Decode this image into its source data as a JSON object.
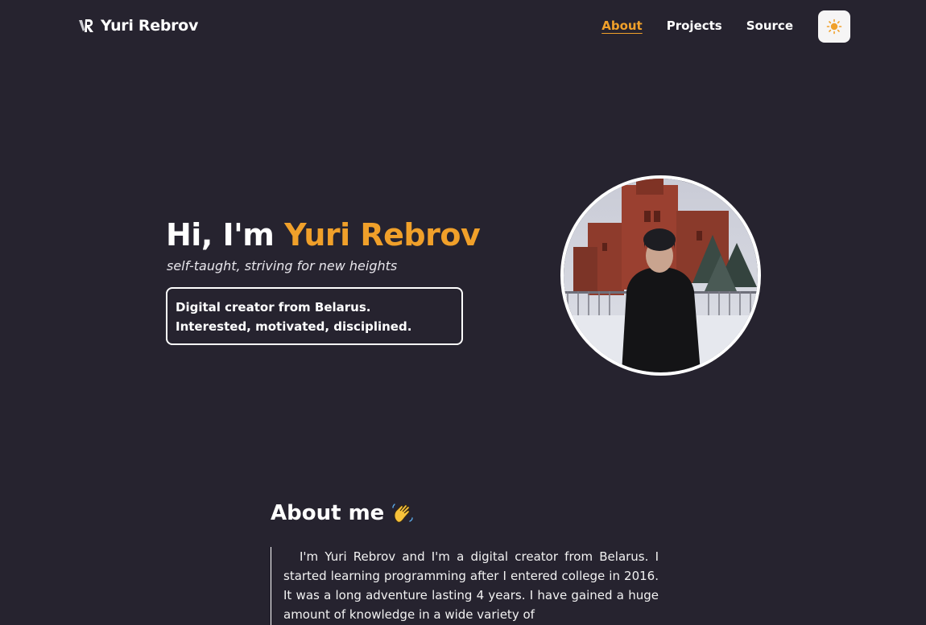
{
  "header": {
    "brand": "Yuri Rebrov",
    "nav": [
      {
        "label": "About",
        "active": true
      },
      {
        "label": "Projects",
        "active": false
      },
      {
        "label": "Source",
        "active": false
      }
    ],
    "theme_toggle_icon": "sun-icon"
  },
  "hero": {
    "greeting": "Hi, I'm ",
    "name": "Yuri Rebrov",
    "subtitle": "self-taught, striving for new heights",
    "box_line1": "Digital creator from Belarus.",
    "box_line2": "Interested, motivated, disciplined."
  },
  "about": {
    "title": "About me",
    "title_icon": "waving-hand-icon",
    "text": "I'm Yuri Rebrov and I'm a digital creator from Belarus. I started learning programming after I entered college in 2016. It was a long adventure lasting 4 years. I have gained a huge amount of knowledge in a wide variety of"
  },
  "colors": {
    "background": "#26232f",
    "accent": "#f0a02a",
    "text": "#ffffff"
  }
}
